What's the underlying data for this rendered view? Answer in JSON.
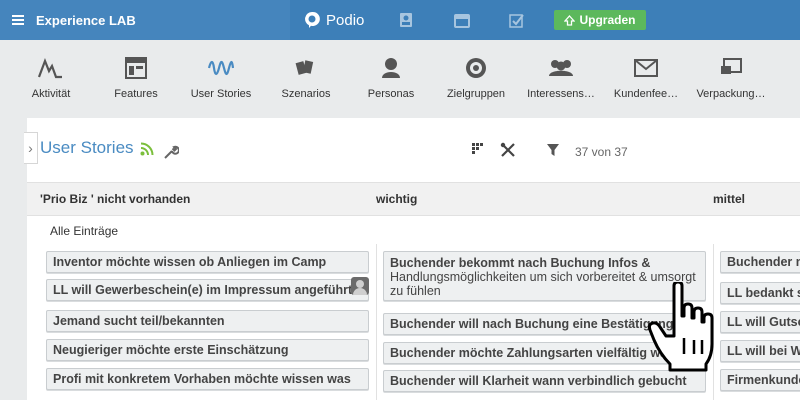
{
  "topbar": {
    "workspace_name": "Experience LAB",
    "brand": "Podio",
    "upgrade_label": "Upgraden"
  },
  "apps": [
    {
      "label": "Aktivität",
      "icon": "activity-icon"
    },
    {
      "label": "Features",
      "icon": "features-icon"
    },
    {
      "label": "User Stories",
      "icon": "wave-icon"
    },
    {
      "label": "Szenarios",
      "icon": "cards-icon"
    },
    {
      "label": "Personas",
      "icon": "person-icon"
    },
    {
      "label": "Zielgruppen",
      "icon": "target-icon"
    },
    {
      "label": "Interessens…",
      "icon": "group-icon"
    },
    {
      "label": "Kundenfee…",
      "icon": "mail-icon"
    },
    {
      "label": "Verpackung…",
      "icon": "screen-icon"
    }
  ],
  "view": {
    "title": "User Stories",
    "count_text": "37 von 37",
    "all_entries": "Alle Einträge"
  },
  "columns": [
    {
      "header": "'Prio Biz ' nicht vorhanden",
      "cards": [
        "Inventor möchte wissen ob Anliegen im Camp",
        "LL will Gewerbeschein(e) im Impressum angeführt",
        "Jemand sucht teil/bekannten",
        "Neugieriger möchte erste Einschätzung",
        "Profi mit konkretem Vorhaben möchte wissen was"
      ]
    },
    {
      "header": "wichtig",
      "tall_card": {
        "line1": "Buchender bekommt nach Buchung Infos &",
        "rest": "Handlungsmöglichkeiten um sich vorbereitet & umsorgt zu fühlen"
      },
      "cards": [
        "Buchender will nach Buchung eine Bestätigung",
        "Buchender möchte Zahlungsarten vielfältig wählen",
        "Buchender will Klarheit wann verbindlich gebucht"
      ]
    },
    {
      "header": "mittel",
      "cards": [
        "Buchender möchte",
        "LL bedankt sich",
        "LL will Gutschein",
        "LL will bei Weiter",
        "Firmenkunde"
      ]
    }
  ]
}
